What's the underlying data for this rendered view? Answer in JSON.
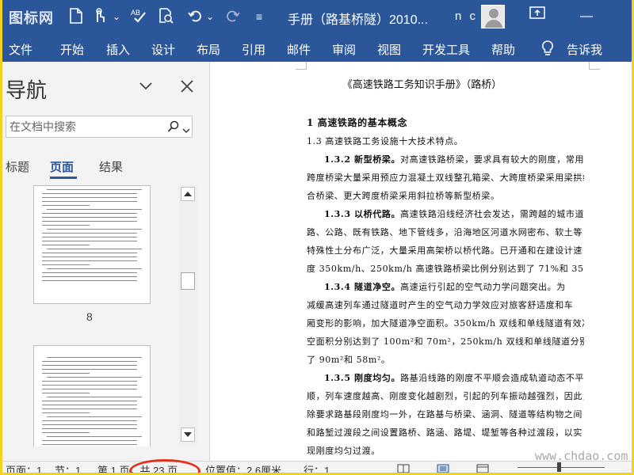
{
  "app": {
    "logo_text": "图标网",
    "doc_title": "手册（路基桥隧）2010...",
    "user_name": "n c"
  },
  "quick_access": {
    "icons": [
      "new-document-icon",
      "touch-mode-icon",
      "dropdown-icon",
      "spelling-check-icon",
      "print-preview-icon",
      "undo-icon",
      "redo-icon"
    ]
  },
  "window": {
    "restore_icon": "ribbon-display-options-icon",
    "minimize_glyph": "—"
  },
  "ribbon": {
    "tabs": [
      "文件",
      "开始",
      "插入",
      "设计",
      "布局",
      "引用",
      "邮件",
      "审阅",
      "视图",
      "开发工具",
      "帮助"
    ],
    "tell_me": "告诉我"
  },
  "nav": {
    "title": "导航",
    "search_placeholder": "在文档中搜索",
    "tabs": [
      "标题",
      "页面",
      "结果"
    ],
    "active_tab": "页面",
    "page_numbers": [
      "8"
    ]
  },
  "document": {
    "heading": "《高速铁路工务知识手册》（路桥）",
    "lines": [
      {
        "style": "h1",
        "text": "1 高速铁路的基本概念"
      },
      {
        "style": "plain",
        "text": "1.3  高速铁路工务设施十大技术特点。"
      },
      {
        "style": "indent",
        "bold": "1.3.2  新型桥梁。",
        "text": "对高速铁路桥梁，要求具有较大的刚度，常用"
      },
      {
        "style": "plain",
        "text": "跨度桥梁大量采用预应力混凝土双线整孔箱梁、大跨度桥梁采用梁拱组"
      },
      {
        "style": "plain",
        "text": "合桥梁、更大跨度桥梁采用斜拉桥等新型桥梁。"
      },
      {
        "style": "indent",
        "bold": "1.3.3  以桥代路。",
        "text": "高速铁路沿线经济社会发达，需跨越的城市道"
      },
      {
        "style": "plain",
        "text": "路、公路、既有铁路、地下管线多，沿海地区河道水网密布、软土等"
      },
      {
        "style": "plain",
        "text": "特殊性土分布广泛，大量采用高架桥以桥代路。已开通和在建设计速"
      },
      {
        "style": "plain",
        "text": "度 350km/h、250km/h 高速铁路桥梁比例分别达到了 71%和 35%。"
      },
      {
        "style": "indent",
        "bold": "1.3.4  隧道净空。",
        "text": "高速运行引起的空气动力学问题突出。为"
      },
      {
        "style": "plain",
        "text": "减缓高速列车通过隧道时产生的空气动力学效应对旅客舒适度和车"
      },
      {
        "style": "plain",
        "text": "厢变形的影响，加大隧道净空面积。350km/h 双线和单线隧道有效净"
      },
      {
        "style": "plain",
        "text": "空面积分别达到了 100m²和 70m²，250km/h 双线和单线隧道分别达到"
      },
      {
        "style": "plain",
        "text": "了 90m²和 58m²。"
      },
      {
        "style": "indent",
        "bold": "1.3.5  刚度均匀。",
        "text": "路基沿线路的刚度不平顺会造成轨道动态不平"
      },
      {
        "style": "plain",
        "text": "顺，列车速度越高、刚度变化越剧烈，引起的列车振动越强烈，因此，"
      },
      {
        "style": "plain",
        "text": "除要求路基段刚度均一外，在路基与桥梁、涵洞、隧道等结构物之间"
      },
      {
        "style": "plain",
        "text": "和路堑过渡段之间设置路桥、路涵、路堤、堤堑等各种过渡段，以实"
      },
      {
        "style": "plain",
        "text": "现刚度均匀过渡。"
      },
      {
        "style": "indent",
        "bold": "1.3.6  沉降控制。",
        "text": "为确保高速铁路正常行车和减少维修量，对工"
      },
      {
        "style": "plain",
        "text": "后沉降控制严格。路基工后沉降：无砟轨道不大于 15mm，250 和 350"
      }
    ]
  },
  "status": {
    "page": "页面：1",
    "section": "节：1",
    "page_of": "第 1 页，共 23 页",
    "position": "位置值：2.6厘米",
    "line": "行：1",
    "watermark": "www.chdao.com"
  },
  "colors": {
    "accent": "#2b579a",
    "frame": "#f2d21c",
    "annotation": "#e0331e"
  }
}
